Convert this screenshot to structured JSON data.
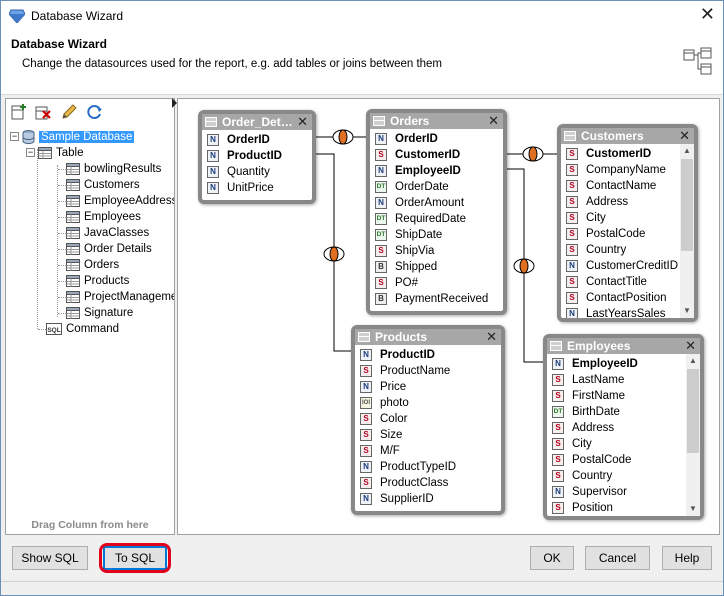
{
  "window": {
    "title": "Database Wizard"
  },
  "header": {
    "title": "Database Wizard",
    "subtitle": "Change the datasources used for the report, e.g. add tables or joins between them"
  },
  "toolbar": {
    "icons": [
      "add-datasource-icon",
      "delete-icon",
      "edit-pencil-icon",
      "refresh-icon"
    ]
  },
  "tree": {
    "root": "Sample Database",
    "table_group": "Table",
    "tables": [
      "bowlingResults",
      "Customers",
      "EmployeeAddresses",
      "Employees",
      "JavaClasses",
      "Order Details",
      "Orders",
      "Products",
      "ProjectManagement",
      "Signature"
    ],
    "command": "Command",
    "sql_badge": "SQL"
  },
  "drag_hint": "Drag Column from here",
  "tables": {
    "order_details": {
      "title": "Order_Det…",
      "fields": [
        {
          "name": "OrderID",
          "type": "N",
          "key": true
        },
        {
          "name": "ProductID",
          "type": "N",
          "key": true
        },
        {
          "name": "Quantity",
          "type": "N",
          "key": false
        },
        {
          "name": "UnitPrice",
          "type": "N",
          "key": false
        }
      ]
    },
    "orders": {
      "title": "Orders",
      "fields": [
        {
          "name": "OrderID",
          "type": "N",
          "key": true
        },
        {
          "name": "CustomerID",
          "type": "S",
          "key": true
        },
        {
          "name": "EmployeeID",
          "type": "N",
          "key": true
        },
        {
          "name": "OrderDate",
          "type": "DT",
          "key": false
        },
        {
          "name": "OrderAmount",
          "type": "N",
          "key": false
        },
        {
          "name": "RequiredDate",
          "type": "DT",
          "key": false
        },
        {
          "name": "ShipDate",
          "type": "DT",
          "key": false
        },
        {
          "name": "ShipVia",
          "type": "S",
          "key": false
        },
        {
          "name": "Shipped",
          "type": "B",
          "key": false
        },
        {
          "name": "PO#",
          "type": "S",
          "key": false
        },
        {
          "name": "PaymentReceived",
          "type": "B",
          "key": false
        }
      ]
    },
    "customers": {
      "title": "Customers",
      "fields": [
        {
          "name": "CustomerID",
          "type": "S",
          "key": true
        },
        {
          "name": "CompanyName",
          "type": "S",
          "key": false
        },
        {
          "name": "ContactName",
          "type": "S",
          "key": false
        },
        {
          "name": "Address",
          "type": "S",
          "key": false
        },
        {
          "name": "City",
          "type": "S",
          "key": false
        },
        {
          "name": "PostalCode",
          "type": "S",
          "key": false
        },
        {
          "name": "Country",
          "type": "S",
          "key": false
        },
        {
          "name": "CustomerCreditID",
          "type": "N",
          "key": false
        },
        {
          "name": "ContactTitle",
          "type": "S",
          "key": false
        },
        {
          "name": "ContactPosition",
          "type": "S",
          "key": false
        },
        {
          "name": "LastYearsSales",
          "type": "N",
          "key": false
        }
      ]
    },
    "products": {
      "title": "Products",
      "fields": [
        {
          "name": "ProductID",
          "type": "N",
          "key": true
        },
        {
          "name": "ProductName",
          "type": "S",
          "key": false
        },
        {
          "name": "Price",
          "type": "N",
          "key": false
        },
        {
          "name": "photo",
          "type": "IO",
          "key": false
        },
        {
          "name": "Color",
          "type": "S",
          "key": false
        },
        {
          "name": "Size",
          "type": "S",
          "key": false
        },
        {
          "name": "M/F",
          "type": "S",
          "key": false
        },
        {
          "name": "ProductTypeID",
          "type": "N",
          "key": false
        },
        {
          "name": "ProductClass",
          "type": "S",
          "key": false
        },
        {
          "name": "SupplierID",
          "type": "N",
          "key": false
        }
      ]
    },
    "employees": {
      "title": "Employees",
      "fields": [
        {
          "name": "EmployeeID",
          "type": "N",
          "key": true
        },
        {
          "name": "LastName",
          "type": "S",
          "key": false
        },
        {
          "name": "FirstName",
          "type": "S",
          "key": false
        },
        {
          "name": "BirthDate",
          "type": "DT",
          "key": false
        },
        {
          "name": "Address",
          "type": "S",
          "key": false
        },
        {
          "name": "City",
          "type": "S",
          "key": false
        },
        {
          "name": "PostalCode",
          "type": "S",
          "key": false
        },
        {
          "name": "Country",
          "type": "S",
          "key": false
        },
        {
          "name": "Supervisor",
          "type": "N",
          "key": false
        },
        {
          "name": "Position",
          "type": "S",
          "key": false
        }
      ]
    }
  },
  "field_type_labels": {
    "N": "N",
    "S": "S",
    "DT": "DT",
    "B": "B",
    "IO": "IOI"
  },
  "buttons": {
    "show_sql": "Show SQL",
    "to_sql": "To SQL",
    "ok": "OK",
    "cancel": "Cancel",
    "help": "Help"
  },
  "colors": {
    "table_header": "#a7a7a7",
    "highlight": "#e3001b",
    "join": "#e07020"
  }
}
